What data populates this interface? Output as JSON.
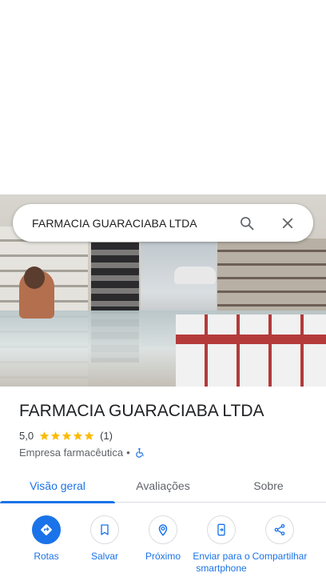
{
  "search": {
    "query": "FARMACIA GUARACIABA LTDA"
  },
  "place": {
    "title": "FARMACIA GUARACIABA LTDA",
    "rating": "5,0",
    "stars": 5,
    "review_count": "(1)",
    "category": "Empresa farmacêutica",
    "separator": "•"
  },
  "tabs": [
    {
      "label": "Visão geral",
      "active": true
    },
    {
      "label": "Avaliações",
      "active": false
    },
    {
      "label": "Sobre",
      "active": false
    }
  ],
  "actions": [
    {
      "label": "Rotas",
      "icon": "directions-icon"
    },
    {
      "label": "Salvar",
      "icon": "bookmark-icon"
    },
    {
      "label": "Próximo",
      "icon": "nearby-icon"
    },
    {
      "label": "Enviar para o smartphone",
      "icon": "send-to-phone-icon"
    },
    {
      "label": "Compartilhar",
      "icon": "share-icon"
    }
  ],
  "colors": {
    "accent": "#1a73e8",
    "star": "#fbbc04",
    "text": "#202124",
    "muted": "#5f6368"
  }
}
